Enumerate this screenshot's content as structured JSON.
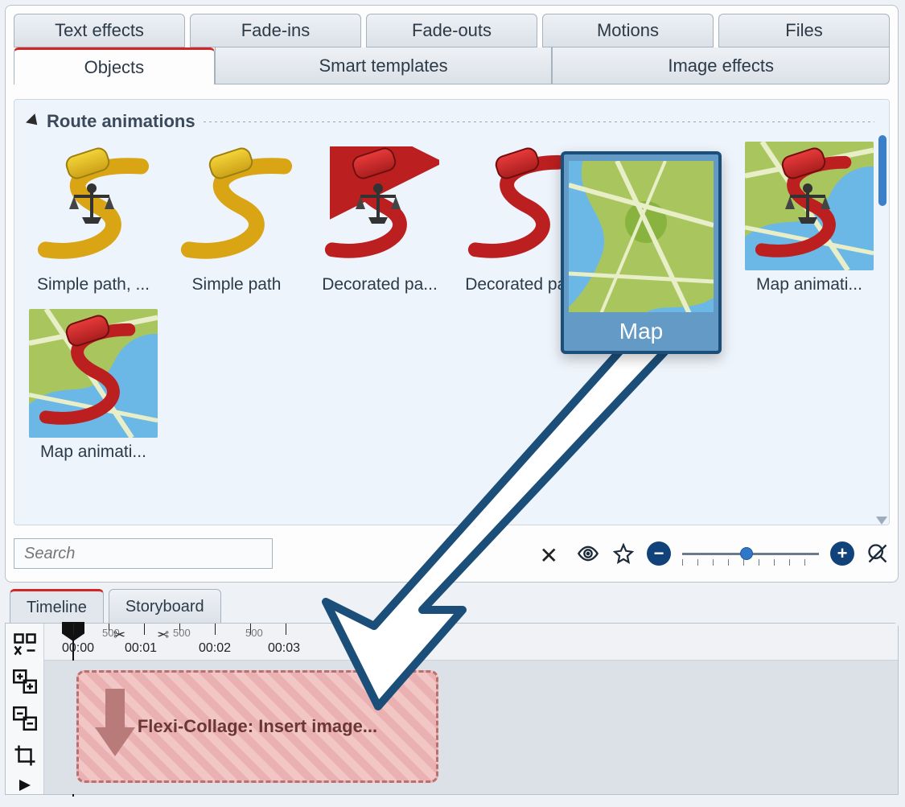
{
  "tabs_top": [
    "Text effects",
    "Fade-ins",
    "Fade-outs",
    "Motions",
    "Files"
  ],
  "tabs_main": {
    "items": [
      "Objects",
      "Smart templates",
      "Image effects"
    ],
    "active": 0
  },
  "section_title": "Route animations",
  "thumbs": {
    "items": [
      "Simple path, ...",
      "Simple path",
      "Decorated pa...",
      "Decorated pa...",
      "Map",
      "Map animati...",
      "Map animati..."
    ]
  },
  "search": {
    "placeholder": "Search"
  },
  "ruler": {
    "labels": [
      "00:00",
      "00:01",
      "00:02",
      "00:03"
    ],
    "small_labels": [
      "500",
      "500",
      "500"
    ]
  },
  "timeline_tabs": {
    "items": [
      "Timeline",
      "Storyboard"
    ],
    "active": 0
  },
  "drop_target_label": "Flexi-Collage: Insert image...",
  "drag_card_label": "Map"
}
